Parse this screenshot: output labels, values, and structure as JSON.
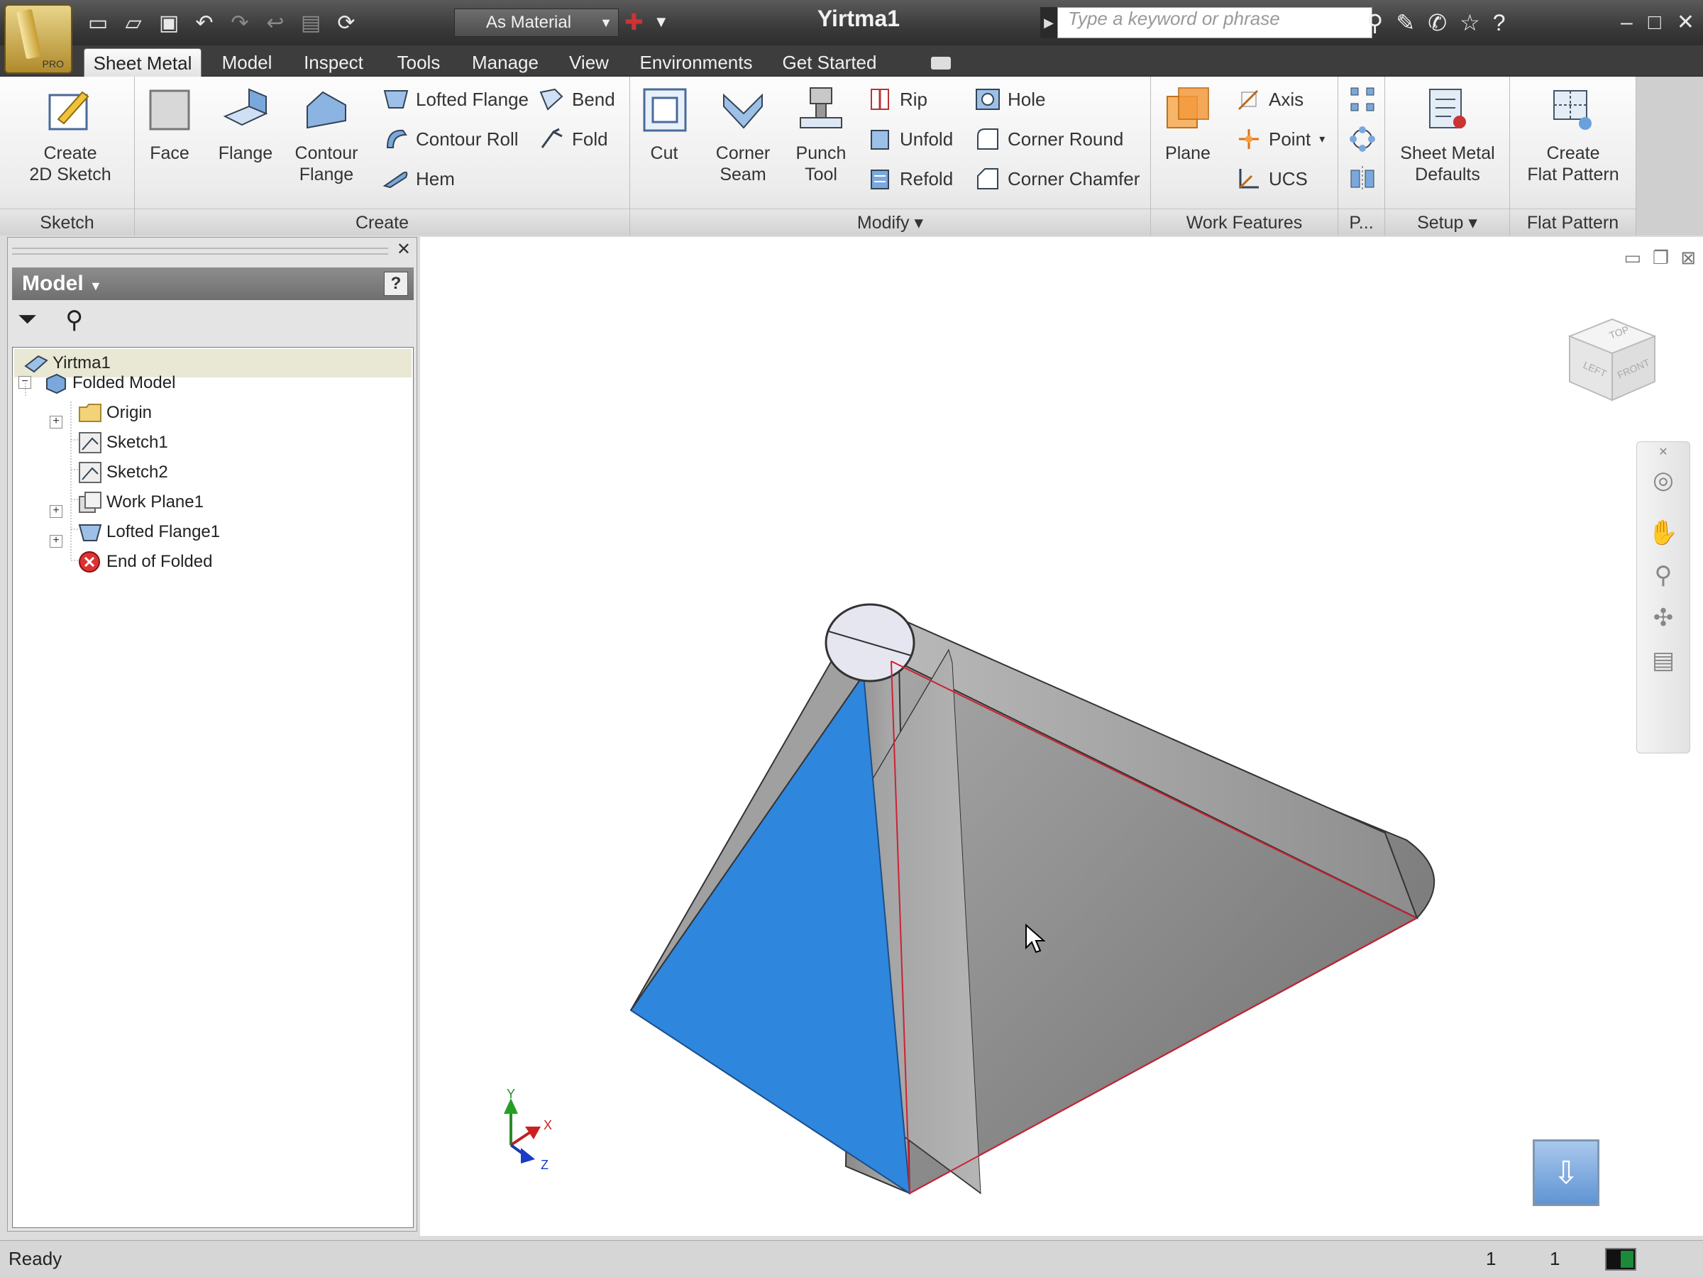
{
  "window": {
    "title": "Yirtma1",
    "material": "As Material",
    "search_placeholder": "Type a keyword or phrase",
    "app_tag": "PRO"
  },
  "tabs": [
    "Sheet Metal",
    "Model",
    "Inspect",
    "Tools",
    "Manage",
    "View",
    "Environments",
    "Get Started"
  ],
  "ribbon": {
    "sketch": {
      "label": "Sketch",
      "create_2d_sketch": [
        "Create",
        "2D Sketch"
      ]
    },
    "create": {
      "label": "Create",
      "face": "Face",
      "flange": "Flange",
      "contour_flange": [
        "Contour",
        "Flange"
      ],
      "lofted_flange": "Lofted Flange",
      "contour_roll": "Contour Roll",
      "hem": "Hem",
      "bend": "Bend",
      "fold": "Fold"
    },
    "modify": {
      "label": "Modify",
      "cut": "Cut",
      "corner_seam": [
        "Corner",
        "Seam"
      ],
      "punch_tool": [
        "Punch",
        "Tool"
      ],
      "rip": "Rip",
      "unfold": "Unfold",
      "refold": "Refold",
      "hole": "Hole",
      "corner_round": "Corner Round",
      "corner_chamfer": "Corner Chamfer"
    },
    "work_features": {
      "label": "Work Features",
      "plane": "Plane",
      "axis": "Axis",
      "point": "Point",
      "ucs": "UCS"
    },
    "pattern": {
      "label": "P..."
    },
    "setup": {
      "label": "Setup",
      "sheet_metal_defaults": [
        "Sheet Metal",
        "Defaults"
      ]
    },
    "flat_pattern": {
      "label": "Flat Pattern",
      "create_flat_pattern": [
        "Create",
        "Flat Pattern"
      ]
    }
  },
  "browser": {
    "title": "Model",
    "tree": [
      {
        "label": "Yirtma1",
        "icon": "part-icon"
      },
      {
        "label": "Folded Model",
        "icon": "folded-model-icon"
      },
      {
        "label": "Origin",
        "icon": "folder-icon"
      },
      {
        "label": "Sketch1",
        "icon": "sketch-icon"
      },
      {
        "label": "Sketch2",
        "icon": "sketch-icon"
      },
      {
        "label": "Work Plane1",
        "icon": "work-plane-icon"
      },
      {
        "label": "Lofted Flange1",
        "icon": "lofted-flange-icon"
      },
      {
        "label": "End of Folded",
        "icon": "end-of-part-icon"
      }
    ]
  },
  "viewcube": {
    "top": "TOP",
    "left": "LEFT",
    "front": "FRONT"
  },
  "triad": {
    "x": "X",
    "y": "Y",
    "z": "Z"
  },
  "colors": {
    "selected_face": "#2f86dd",
    "part_gray": "#7a7a7a",
    "edge_highlight": "#cc2233"
  },
  "status": {
    "text": "Ready",
    "num1": "1",
    "num2": "1"
  }
}
